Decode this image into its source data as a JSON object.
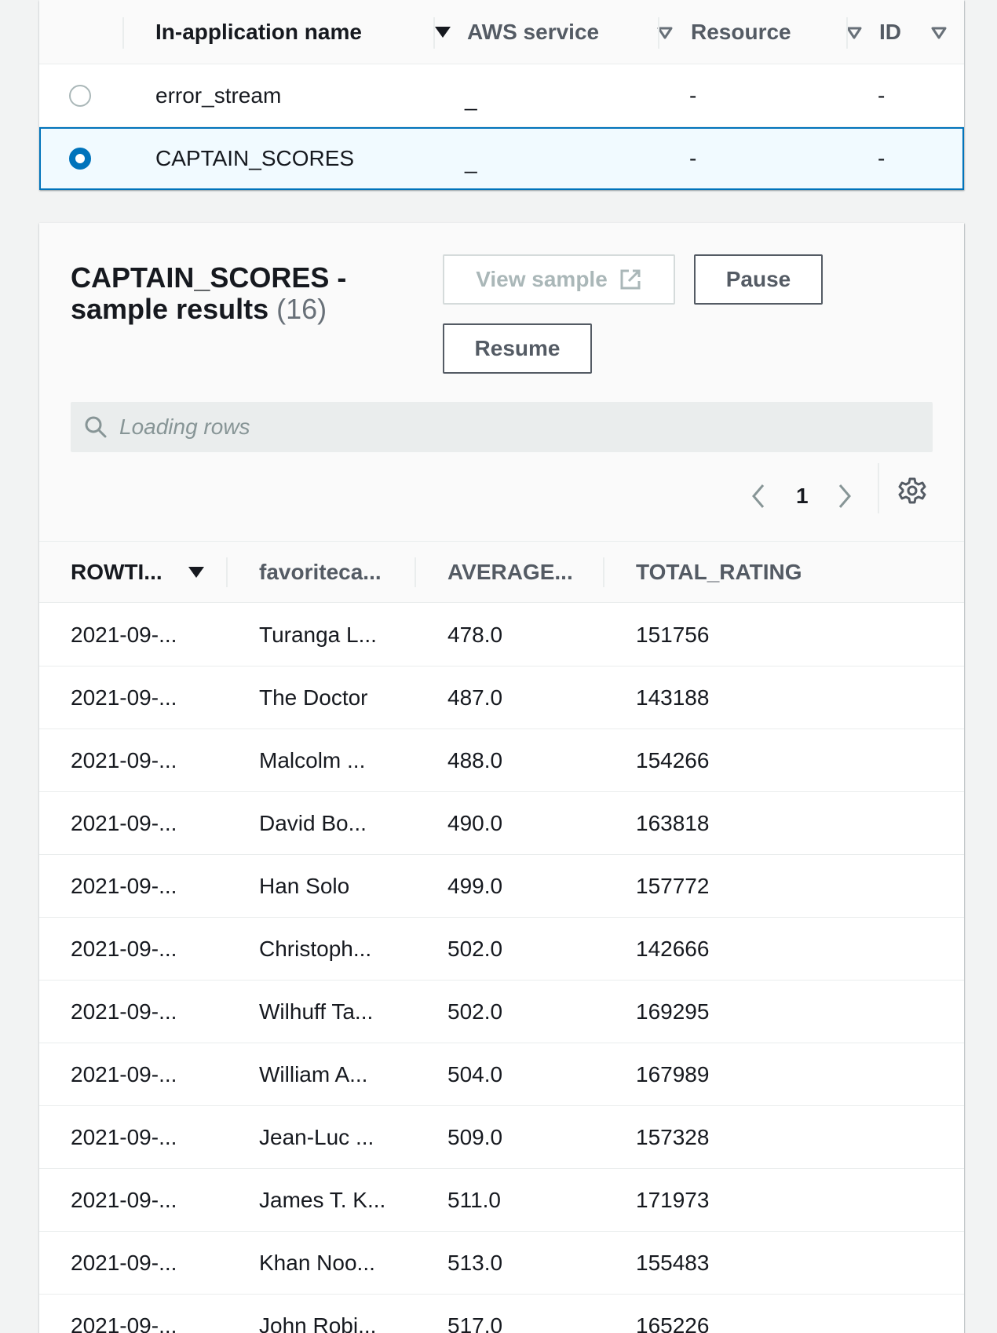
{
  "streams_table": {
    "columns": [
      {
        "label": "In-application name",
        "sort": "active"
      },
      {
        "label": "AWS service",
        "sort": "inactive"
      },
      {
        "label": "Resource",
        "sort": "inactive"
      },
      {
        "label": "ID",
        "sort": "inactive"
      }
    ],
    "rows": [
      {
        "name": "error_stream",
        "service": "_",
        "resource": "-",
        "id": "-",
        "selected": false
      },
      {
        "name": "CAPTAIN_SCORES",
        "service": "_",
        "resource": "-",
        "id": "-",
        "selected": true
      }
    ]
  },
  "results": {
    "title": "CAPTAIN_SCORES - sample results",
    "count": "(16)",
    "view_sample_label": "View sample",
    "pause_label": "Pause",
    "resume_label": "Resume",
    "search_placeholder": "Loading rows",
    "current_page": "1",
    "columns": [
      "ROWTI...",
      "favoriteca...",
      "AVERAGE...",
      "TOTAL_RATING"
    ],
    "rows": [
      [
        "2021-09-...",
        "Turanga L...",
        "478.0",
        "151756"
      ],
      [
        "2021-09-...",
        "The Doctor",
        "487.0",
        "143188"
      ],
      [
        "2021-09-...",
        "Malcolm ...",
        "488.0",
        "154266"
      ],
      [
        "2021-09-...",
        "David Bo...",
        "490.0",
        "163818"
      ],
      [
        "2021-09-...",
        "Han Solo",
        "499.0",
        "157772"
      ],
      [
        "2021-09-...",
        "Christoph...",
        "502.0",
        "142666"
      ],
      [
        "2021-09-...",
        "Wilhuff Ta...",
        "502.0",
        "169295"
      ],
      [
        "2021-09-...",
        "William A...",
        "504.0",
        "167989"
      ],
      [
        "2021-09-...",
        "Jean-Luc ...",
        "509.0",
        "157328"
      ],
      [
        "2021-09-...",
        "James T. K...",
        "511.0",
        "171973"
      ],
      [
        "2021-09-...",
        "Khan Noo...",
        "513.0",
        "155483"
      ],
      [
        "2021-09-...",
        "John Robi...",
        "517.0",
        "165226"
      ]
    ]
  },
  "colors": {
    "accent": "#0073bb",
    "selected_bg": "#f1faff",
    "page_bg": "#f2f3f3"
  }
}
